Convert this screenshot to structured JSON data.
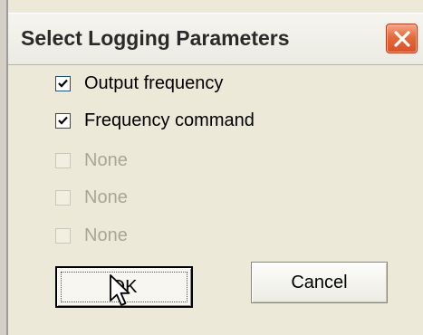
{
  "window": {
    "title": "Select Logging Parameters",
    "close_icon": "close-x-icon"
  },
  "parameters": [
    {
      "label": "Output frequency",
      "checked": true,
      "enabled": true
    },
    {
      "label": "Frequency command",
      "checked": true,
      "enabled": true
    },
    {
      "label": "None",
      "checked": false,
      "enabled": false
    },
    {
      "label": "None",
      "checked": false,
      "enabled": false
    },
    {
      "label": "None",
      "checked": false,
      "enabled": false
    }
  ],
  "buttons": {
    "ok_label": "OK",
    "cancel_label": "Cancel"
  },
  "colors": {
    "close_button": "#e46a3c",
    "dialog_face": "#ece9d8",
    "disabled_text": "#a8a695"
  }
}
